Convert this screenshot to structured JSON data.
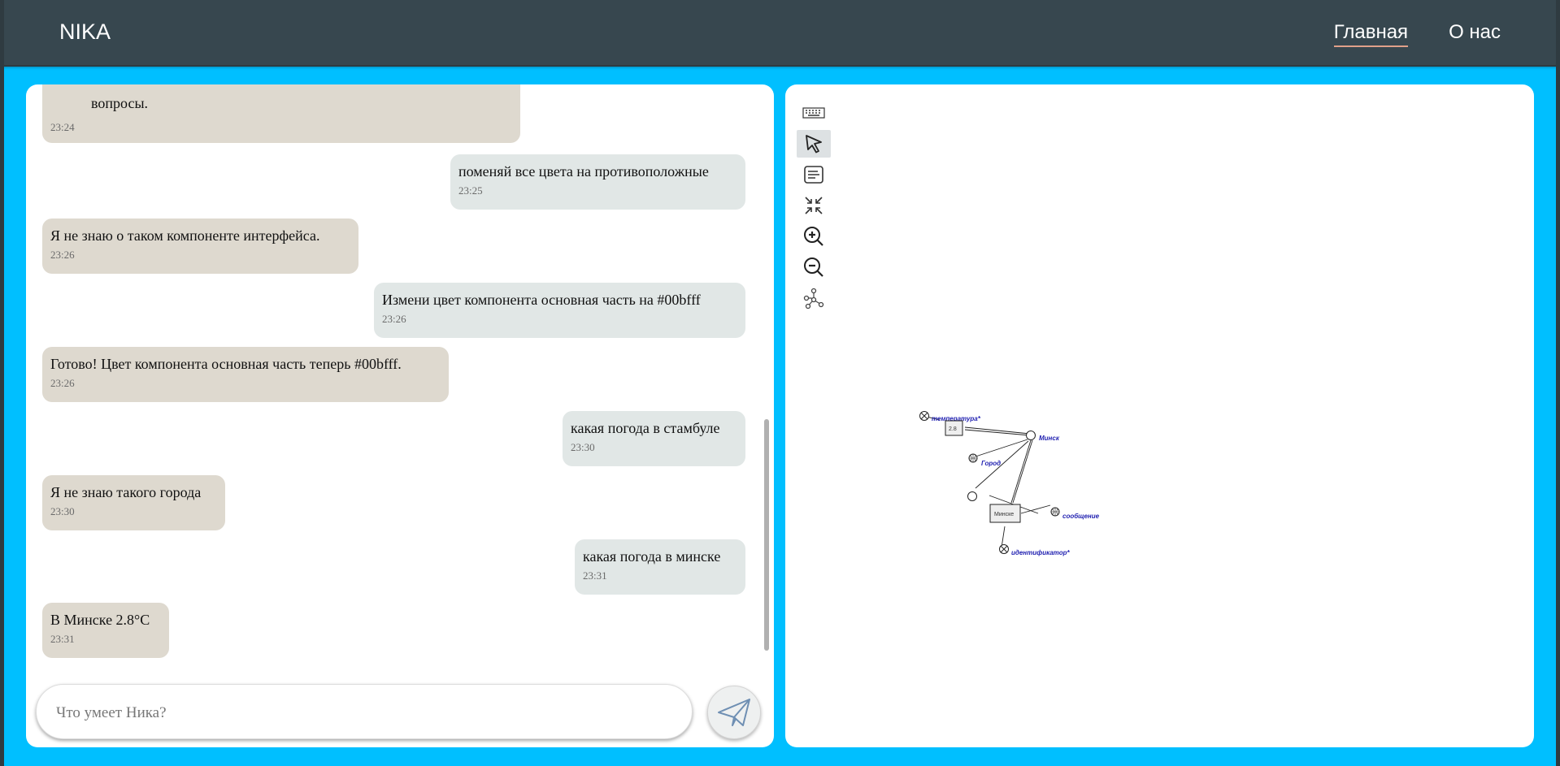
{
  "header": {
    "brand": "NIKA",
    "nav": [
      {
        "label": "Главная",
        "active": true
      },
      {
        "label": "О нас",
        "active": false
      }
    ]
  },
  "chat": {
    "messages": [
      {
        "sender": "bot",
        "text": "вопросы.",
        "time": "23:24"
      },
      {
        "sender": "user",
        "text": "поменяй все цвета на противоположные",
        "time": "23:25"
      },
      {
        "sender": "bot",
        "text": "Я не знаю о таком компоненте интерфейса.",
        "time": "23:26"
      },
      {
        "sender": "user",
        "text": "Измени цвет компонента основная часть на #00bfff",
        "time": "23:26"
      },
      {
        "sender": "bot",
        "text": "Готово! Цвет компонента основная часть теперь #00bfff.",
        "time": "23:26"
      },
      {
        "sender": "user",
        "text": "какая погода в стамбуле",
        "time": "23:30"
      },
      {
        "sender": "bot",
        "text": "Я не знаю такого города",
        "time": "23:30"
      },
      {
        "sender": "user",
        "text": "какая погода в минске",
        "time": "23:31"
      },
      {
        "sender": "bot",
        "text": "В Минске 2.8°C",
        "time": "23:31"
      }
    ],
    "input": {
      "value": "",
      "placeholder": "Что умеет Ника?"
    },
    "send_icon": "paper-plane-icon"
  },
  "graph_toolbar": [
    {
      "icon": "keyboard-icon",
      "active": false
    },
    {
      "icon": "cursor-icon",
      "active": true
    },
    {
      "icon": "text-lines-icon",
      "active": false
    },
    {
      "icon": "collapse-arrows-icon",
      "active": false
    },
    {
      "icon": "zoom-in-icon",
      "active": false
    },
    {
      "icon": "zoom-out-icon",
      "active": false
    },
    {
      "icon": "graph-nodes-icon",
      "active": false
    }
  ],
  "graph": {
    "labels": {
      "temperature": "температура*",
      "box_value": "2.8",
      "minsk_node": "Минск",
      "city": "Город",
      "minsk_box": "Минске",
      "message": "сообщение",
      "identifier": "идентификатор*"
    }
  },
  "colors": {
    "main_bg": "#00bfff",
    "header_bg": "#37474f",
    "bot_bubble": "#ded9cf",
    "user_bubble": "#e1e7e6",
    "graph_label": "#1f1fb0"
  }
}
